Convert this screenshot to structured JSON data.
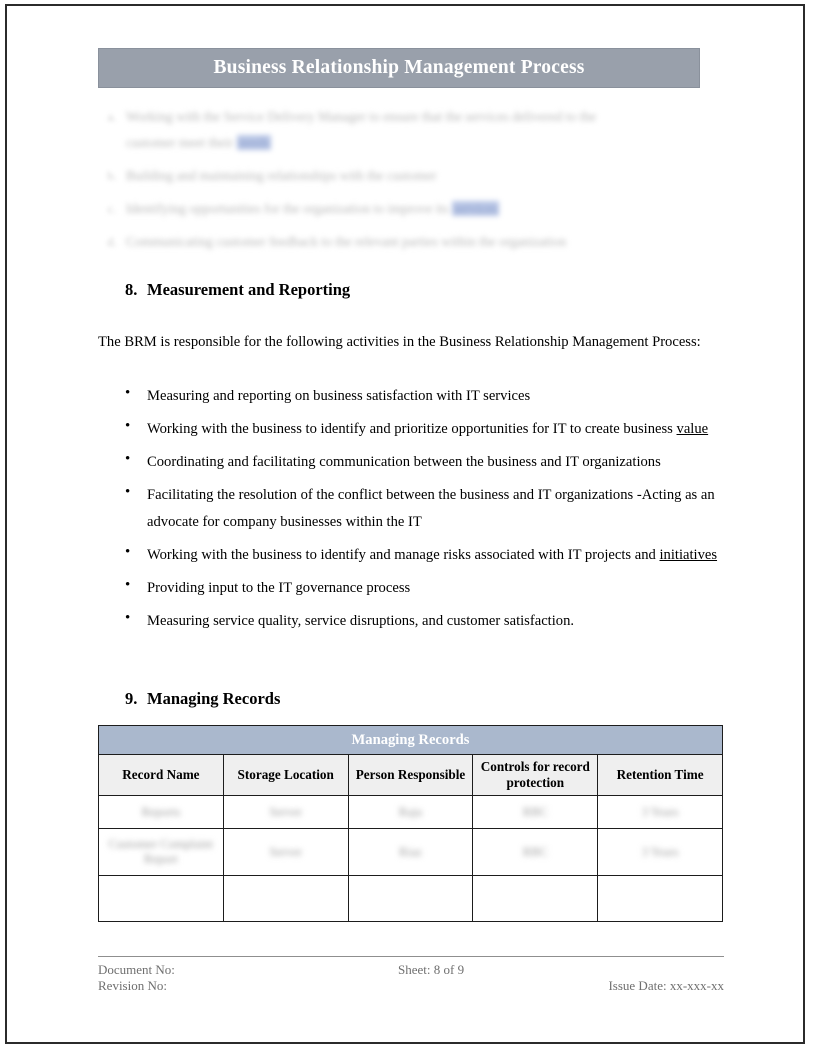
{
  "document": {
    "banner_title": "Business Relationship Management Process",
    "accent_banner_color": "#99a0ab",
    "table_title_color": "#aab8cd",
    "column_header_color": "#efefef",
    "redacted_text_color": "#b7b7b7",
    "highlight_color": "#b9c6e6"
  },
  "redacted_bullets": [
    {
      "marker": "a.",
      "lines": [
        {
          "text": "Working with the Service Delivery Manager to ensure that the services delivered to the",
          "highlight": ""
        },
        {
          "text": "customer meet their ",
          "highlight": "needs"
        }
      ]
    },
    {
      "marker": "b.",
      "lines": [
        {
          "text": "Building and maintaining relationships with the customer",
          "highlight": ""
        }
      ]
    },
    {
      "marker": "c.",
      "lines": [
        {
          "text": "Identifying opportunities for the organization to improve its ",
          "highlight": "services"
        }
      ]
    },
    {
      "marker": "d.",
      "lines": [
        {
          "text": "Communicating customer feedback to the relevant parties within the organization",
          "highlight": ""
        }
      ]
    }
  ],
  "section_8": {
    "number": "8.",
    "title": "Measurement and Reporting",
    "intro": "The BRM is responsible for the following activities in the Business Relationship Management Process:",
    "bullets": [
      {
        "marker": "•",
        "text": "Measuring and reporting on business satisfaction with IT services",
        "underline": "",
        "justify": false
      },
      {
        "marker": "•",
        "text": "Working with the business to identify and prioritize opportunities for IT to create business ",
        "underline": "value",
        "justify": true
      },
      {
        "marker": "•",
        "text": "Coordinating and facilitating communication between the business and IT organizations",
        "underline": "",
        "justify": false
      },
      {
        "marker": "•",
        "text": "Facilitating the resolution of the conflict between the business and IT organizations -Acting as an advocate for company businesses within the IT",
        "underline": "",
        "justify": false
      },
      {
        "marker": "•",
        "text": "Working with the business to identify and manage risks associated with IT projects and ",
        "underline": "initiatives",
        "justify": true
      },
      {
        "marker": "•",
        "text": "Providing input to the IT governance process",
        "underline": "",
        "justify": false
      },
      {
        "marker": "•",
        "text": "Measuring service quality, service disruptions, and customer satisfaction.",
        "underline": "",
        "justify": false
      }
    ]
  },
  "section_9": {
    "number": "9.",
    "title": "Managing Records",
    "table": {
      "title": "Managing Records",
      "columns": [
        "Record Name",
        "Storage Location",
        "Person Responsible",
        "Controls for record protection",
        "Retention Time"
      ],
      "rows": [
        {
          "cells": [
            "Reports",
            "Server",
            "Raju",
            "RBC",
            "3 Years"
          ],
          "redacted": true,
          "tall": false
        },
        {
          "cells": [
            "Customer Complaint Report",
            "Server",
            "Riaz",
            "RBC",
            "3 Years"
          ],
          "redacted": true,
          "tall": true
        },
        {
          "cells": [
            "",
            "",
            "",
            "",
            ""
          ],
          "redacted": false,
          "tall": false
        }
      ]
    }
  },
  "footer": {
    "document_no": "Document No:",
    "revision_no": "Revision No:",
    "sheet": "Sheet: 8 of 9",
    "issue_date": "Issue Date: xx-xxx-xx"
  }
}
